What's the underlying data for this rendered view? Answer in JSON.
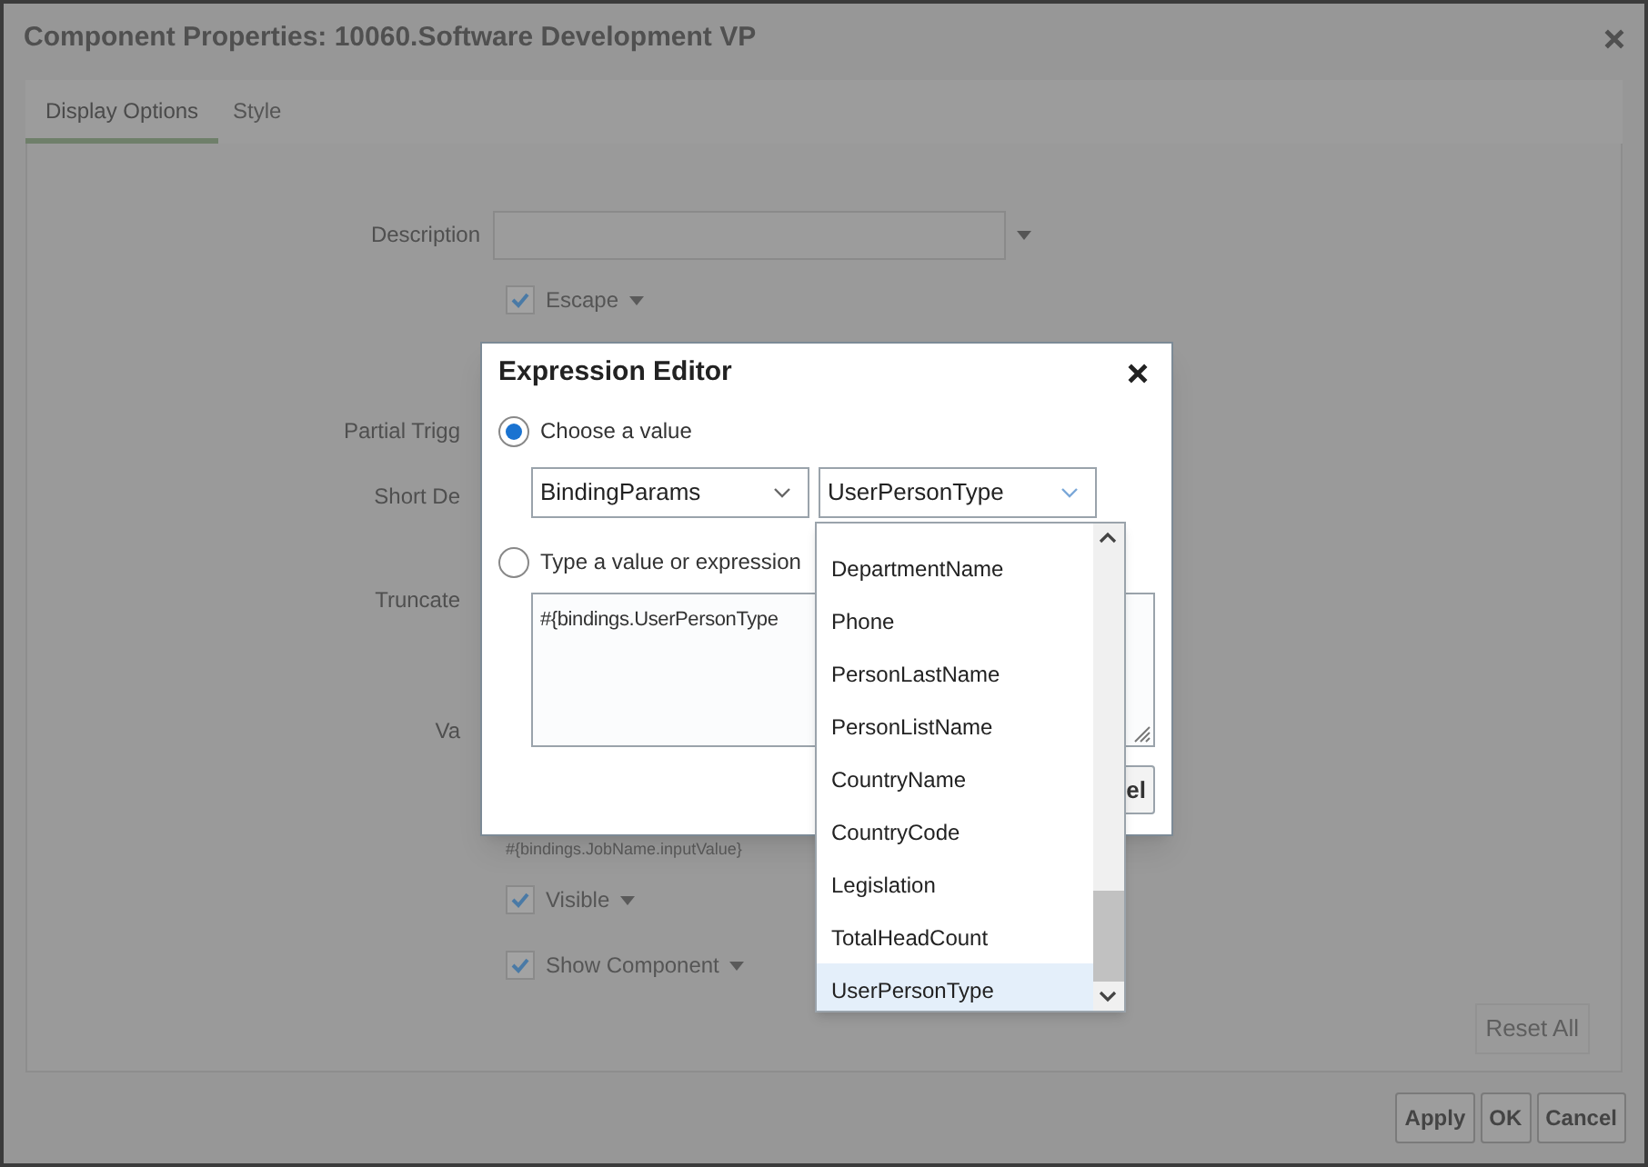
{
  "window": {
    "title": "Component Properties: 10060.Software Development VP"
  },
  "tabs": [
    {
      "label": "Display Options",
      "selected": true
    },
    {
      "label": "Style",
      "selected": false
    }
  ],
  "form": [
    {
      "kind": "select",
      "label": "Description"
    },
    {
      "kind": "checkbox",
      "label": "Escape",
      "checked": true
    },
    {
      "kind": "covered",
      "label": "Partial Trigg"
    },
    {
      "kind": "covered",
      "label": "Short De"
    },
    {
      "kind": "covered",
      "label": "Truncate"
    },
    {
      "kind": "covered",
      "label": "Va"
    },
    {
      "kind": "hint",
      "label": "#{bindings.JobName.inputValue}"
    },
    {
      "kind": "checkbox",
      "label": "Visible",
      "checked": true
    },
    {
      "kind": "checkbox",
      "label": "Show Component",
      "checked": true
    }
  ],
  "reset_button": {
    "label": "Reset All",
    "disabled": true
  },
  "footer_buttons": [
    "Apply",
    "OK",
    "Cancel"
  ],
  "expression_editor": {
    "title": "Expression Editor",
    "options": [
      {
        "label": "Choose a value",
        "selected": true
      },
      {
        "label": "Type a value or expression",
        "selected": false
      }
    ],
    "selects": [
      "BindingParams",
      "UserPersonType"
    ],
    "expression": "#{bindings.UserPersonType",
    "button": "el"
  },
  "dropdown": {
    "items": [
      {
        "label": "DepartmentName",
        "selected": false
      },
      {
        "label": "Phone",
        "selected": false
      },
      {
        "label": "PersonLastName",
        "selected": false
      },
      {
        "label": "PersonListName",
        "selected": false
      },
      {
        "label": "CountryName",
        "selected": false
      },
      {
        "label": "CountryCode",
        "selected": false
      },
      {
        "label": "Legislation",
        "selected": false
      },
      {
        "label": "TotalHeadCount",
        "selected": false
      },
      {
        "label": "UserPersonType",
        "selected": true
      }
    ]
  }
}
